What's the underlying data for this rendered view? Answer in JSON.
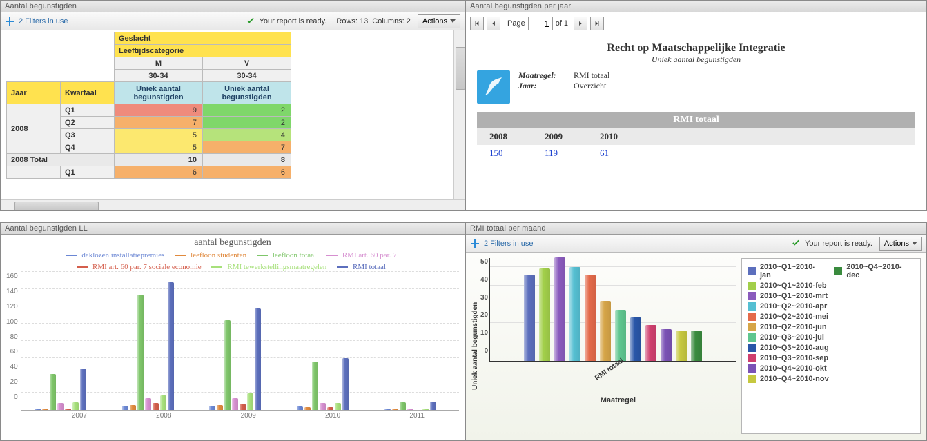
{
  "colors": {
    "series": {
      "daklozen": "#6b87d4",
      "leefloon_stud": "#e08a3e",
      "leefloon_totaal": "#7fc66a",
      "rmi_art60": "#d68fd0",
      "rmi_art60_soceco": "#d45e4c",
      "rmi_tewerk": "#a7e07b",
      "rmi_totaal": "#5c6fbd"
    },
    "months": {
      "jan": "#5c6fbd",
      "feb": "#a2cf4a",
      "mrt": "#8a5bbd",
      "apr": "#55bfd2",
      "mei": "#e46a4a",
      "jun": "#d6a548",
      "jul": "#5fc68f",
      "aug": "#2956a8",
      "sep": "#cf3f6e",
      "okt": "#7b52b5",
      "nov": "#c6c83f",
      "dec": "#3a8b3e"
    }
  },
  "panels": {
    "p1": {
      "title": "Aantal begunstigden",
      "filters_label": "2 Filters in use",
      "ready_label": "Your report is ready.",
      "rows_label": "Rows: 13",
      "cols_label": "Columns: 2",
      "actions_label": "Actions",
      "headers": {
        "geslacht": "Geslacht",
        "leeftijd": "Leeftijdscategorie",
        "gender_m": "M",
        "gender_v": "V",
        "age": "30-34",
        "measure": "Uniek aantal begunstigden",
        "jaar": "Jaar",
        "kwartaal": "Kwartaal",
        "total2008": "2008 Total"
      },
      "rows": {
        "y2008": {
          "label": "2008",
          "q1": {
            "label": "Q1",
            "m": 9,
            "mclass": "c-red",
            "v": 2,
            "vclass": "c-green"
          },
          "q2": {
            "label": "Q2",
            "m": 7,
            "mclass": "c-orange",
            "v": 2,
            "vclass": "c-green"
          },
          "q3": {
            "label": "Q3",
            "m": 5,
            "mclass": "c-yellow",
            "v": 4,
            "vclass": "c-lgreen"
          },
          "q4": {
            "label": "Q4",
            "m": 5,
            "mclass": "c-yellow",
            "v": 7,
            "vclass": "c-orange"
          }
        },
        "total2008": {
          "m": 10,
          "v": 8
        },
        "next": {
          "q1": {
            "label": "Q1",
            "m": 6,
            "mclass": "c-orange",
            "v": 6,
            "vclass": "c-orange"
          }
        }
      }
    },
    "p2": {
      "title": "Aantal begunstigden per jaar",
      "page_label": "Page",
      "page_value": "1",
      "page_of": "of 1",
      "rpt_title": "Recht op Maatschappelijke Integratie",
      "rpt_sub": "Uniek aantal begunstigden",
      "meta_maatregel_label": "Maatregel:",
      "meta_maatregel_value": "RMI totaal",
      "meta_jaar_label": "Jaar:",
      "meta_jaar_value": "Overzicht",
      "table_header": "RMI totaal",
      "years": {
        "y2008": "2008",
        "y2009": "2009",
        "y2010": "2010"
      },
      "values": {
        "y2008": "150",
        "y2009": "119",
        "y2010": "61"
      }
    },
    "p3": {
      "title": "Aantal begunstigden LL",
      "chart_title": "aantal begunstigden",
      "legend": {
        "s1": "daklozen installatiepremies",
        "s2": "leefloon studenten",
        "s3": "leefloon totaal",
        "s4": "RMI art. 60 par. 7",
        "s5": "RMI art. 60 par. 7 sociale economie",
        "s6": "RMI tewerkstellingsmaatregelen",
        "s7": "RMI totaal"
      },
      "yaxis_ticks": [
        "160",
        "140",
        "120",
        "100",
        "80",
        "60",
        "40",
        "20",
        "0"
      ]
    },
    "p4": {
      "title": "RMI totaal per maand",
      "filters_label": "2 Filters in use",
      "ready_label": "Your report is ready.",
      "actions_label": "Actions",
      "yaxis_label": "Uniek aantal begunstigden",
      "yaxis_ticks": [
        "50",
        "40",
        "30",
        "20",
        "10",
        "0"
      ],
      "xaxis_cat": "RMI totaal",
      "xaxis_label": "Maatregel",
      "legend": {
        "jan": "2010~Q1~2010-jan",
        "dec": "2010~Q4~2010-dec",
        "feb": "2010~Q1~2010-feb",
        "mrt": "2010~Q1~2010-mrt",
        "apr": "2010~Q2~2010-apr",
        "mei": "2010~Q2~2010-mei",
        "jun": "2010~Q2~2010-jun",
        "jul": "2010~Q3~2010-jul",
        "aug": "2010~Q3~2010-aug",
        "sep": "2010~Q3~2010-sep",
        "okt": "2010~Q4~2010-okt",
        "nov": "2010~Q4~2010-nov"
      }
    }
  },
  "chart_data": [
    {
      "panel": "p3",
      "type": "bar",
      "title": "aantal begunstigden",
      "xlabel": "",
      "ylabel": "",
      "ylim": [
        0,
        160
      ],
      "categories": [
        "2007",
        "2008",
        "2009",
        "2010",
        "2011"
      ],
      "series": [
        {
          "name": "daklozen installatiepremies",
          "values": [
            2,
            5,
            5,
            4,
            1
          ]
        },
        {
          "name": "leefloon studenten",
          "values": [
            2,
            6,
            6,
            3,
            1
          ]
        },
        {
          "name": "leefloon totaal",
          "values": [
            42,
            134,
            104,
            56,
            9
          ]
        },
        {
          "name": "RMI art. 60 par. 7",
          "values": [
            8,
            14,
            14,
            8,
            2
          ]
        },
        {
          "name": "RMI art. 60 par. 7 sociale economie",
          "values": [
            2,
            8,
            7,
            3,
            0
          ]
        },
        {
          "name": "RMI tewerkstellingsmaatregelen",
          "values": [
            9,
            17,
            19,
            8,
            2
          ]
        },
        {
          "name": "RMI totaal",
          "values": [
            48,
            148,
            118,
            60,
            10
          ]
        }
      ]
    },
    {
      "panel": "p4",
      "type": "bar",
      "xlabel": "Maatregel",
      "ylabel": "Uniek aantal begunstigden",
      "ylim": [
        0,
        55
      ],
      "categories": [
        "RMI totaal"
      ],
      "series": [
        {
          "name": "2010~Q1~2010-jan",
          "values": [
            46
          ]
        },
        {
          "name": "2010~Q1~2010-feb",
          "values": [
            49
          ]
        },
        {
          "name": "2010~Q1~2010-mrt",
          "values": [
            55
          ]
        },
        {
          "name": "2010~Q2~2010-apr",
          "values": [
            50
          ]
        },
        {
          "name": "2010~Q2~2010-mei",
          "values": [
            46
          ]
        },
        {
          "name": "2010~Q2~2010-jun",
          "values": [
            32
          ]
        },
        {
          "name": "2010~Q3~2010-jul",
          "values": [
            27
          ]
        },
        {
          "name": "2010~Q3~2010-aug",
          "values": [
            23
          ]
        },
        {
          "name": "2010~Q3~2010-sep",
          "values": [
            19
          ]
        },
        {
          "name": "2010~Q4~2010-okt",
          "values": [
            17
          ]
        },
        {
          "name": "2010~Q4~2010-nov",
          "values": [
            16
          ]
        },
        {
          "name": "2010~Q4~2010-dec",
          "values": [
            16
          ]
        }
      ]
    }
  ]
}
